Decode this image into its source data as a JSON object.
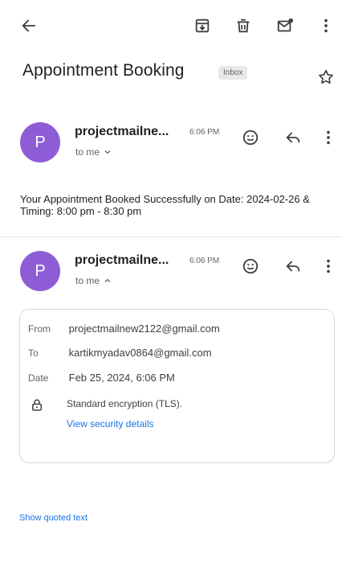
{
  "toolbar": {
    "back_icon": "arrow-left-icon",
    "archive_icon": "archive-icon",
    "delete_icon": "trash-icon",
    "unread_icon": "mark-unread-icon",
    "more_icon": "more-vert-icon"
  },
  "subject": {
    "title": "Appointment Booking",
    "label": "Inbox"
  },
  "messages": [
    {
      "avatar_letter": "P",
      "sender": "projectmailne...",
      "time": "6:06 PM",
      "to": "to me",
      "expanded": false
    },
    {
      "avatar_letter": "P",
      "sender": "projectmailne...",
      "time": "6:06 PM",
      "to": "to me",
      "expanded": true
    }
  ],
  "snippet": "Your Appointment Booked Successfully on Date: 2024-02-26 & Timing: 8:00 pm - 8:30 pm",
  "details": {
    "from_label": "From",
    "from_value": "projectmailnew2122@gmail.com",
    "to_label": "To",
    "to_value": "kartikmyadav0864@gmail.com",
    "date_label": "Date",
    "date_value": "Feb 25, 2024, 6:06 PM",
    "encryption": "Standard encryption (TLS).",
    "security_link": "View security details"
  },
  "quoted_link": "Show quoted text",
  "colors": {
    "avatar": "#8e5dd6",
    "link": "#1a73e8",
    "secondary_text": "#5f6368"
  }
}
